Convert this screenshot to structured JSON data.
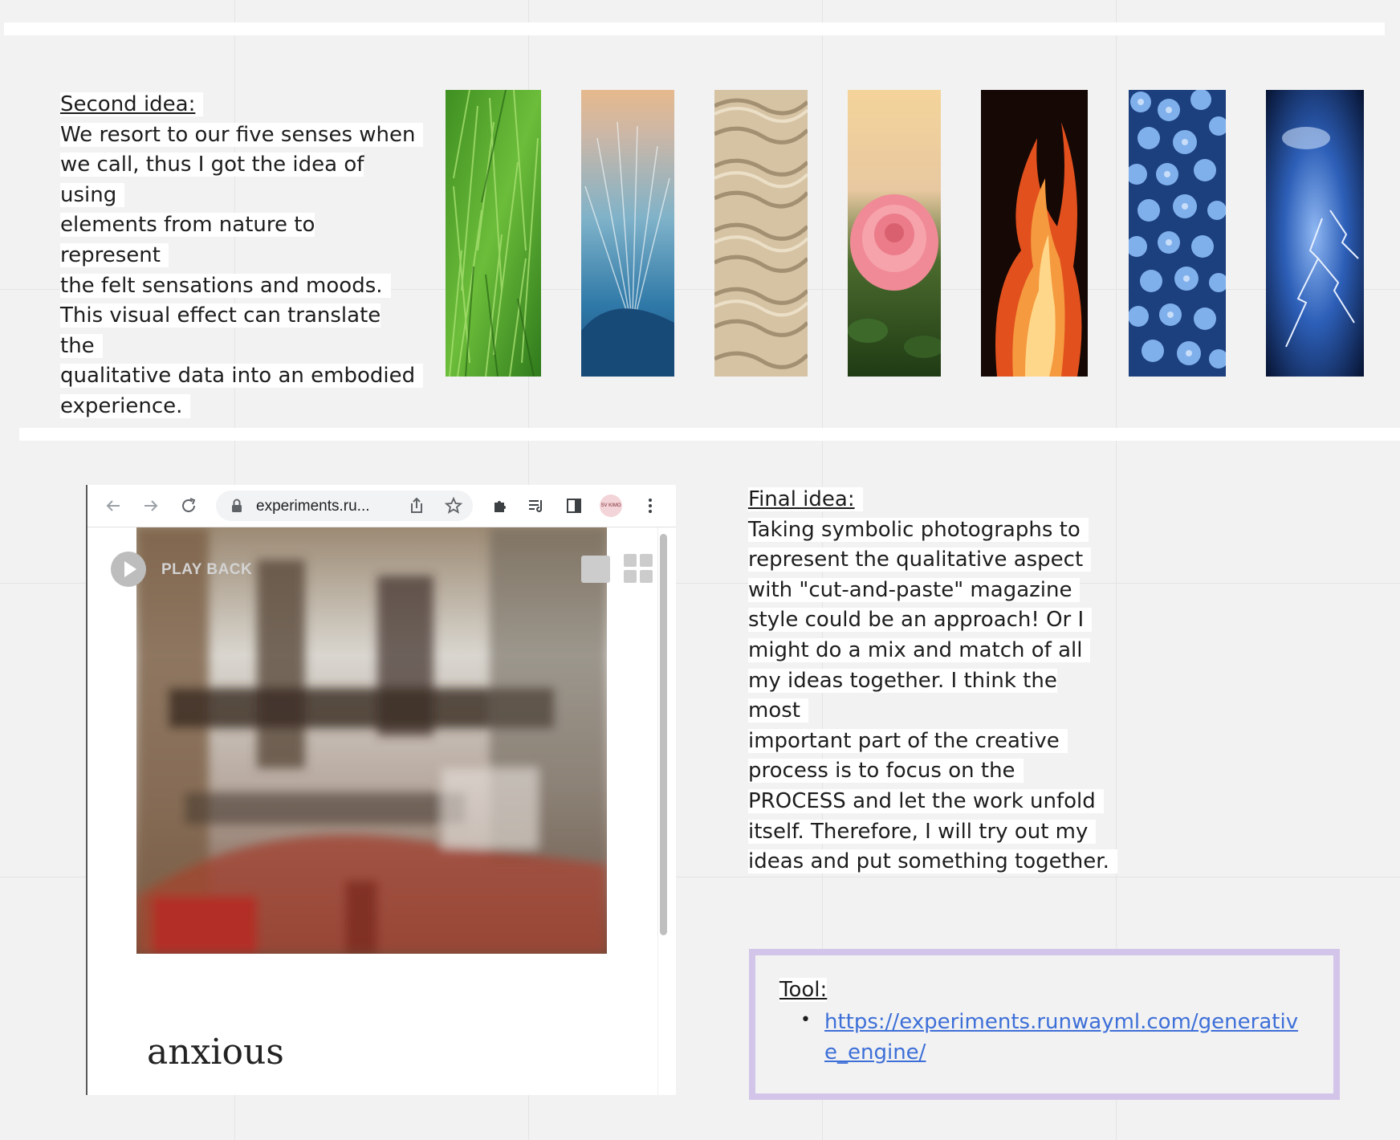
{
  "second_idea": {
    "heading": "Second idea:",
    "lines": [
      "We resort to our five senses when",
      "we call, thus I got the idea of using",
      "elements from nature to represent",
      "the felt sensations and moods.",
      "This visual effect can translate the",
      "qualitative data into an embodied",
      "experience."
    ]
  },
  "nature_images": [
    "grass",
    "ocean-wave",
    "sand-ripples",
    "pink-rose",
    "fire",
    "blue-hydrangeas",
    "lightning-storm"
  ],
  "browser": {
    "url": "experiments.ru...",
    "icons": [
      "back-arrow-icon",
      "forward-arrow-icon",
      "reload-icon",
      "lock-icon",
      "share-icon",
      "star-icon",
      "extensions-icon",
      "reading-list-icon",
      "side-panel-icon",
      "menu-dots-icon"
    ],
    "avatar_text": "SV KIMO",
    "play_back_label": "PLAY BACK",
    "mood_word": "anxious"
  },
  "final_idea": {
    "heading": "Final idea:",
    "lines": [
      "Taking symbolic photographs to",
      "represent the qualitative aspect",
      "with \"cut-and-paste\" magazine",
      "style could be an approach! Or I",
      "might do a mix and match of all",
      "my ideas together. I think the most",
      "important part of the creative",
      "process is to focus on the",
      "PROCESS and let the work unfold",
      "itself. Therefore, I will try out my",
      "ideas and put something together."
    ]
  },
  "tool": {
    "label": "Tool:",
    "link": "https://experiments.runwayml.com/generative_engine/",
    "box_color": "#d3c5ea"
  }
}
